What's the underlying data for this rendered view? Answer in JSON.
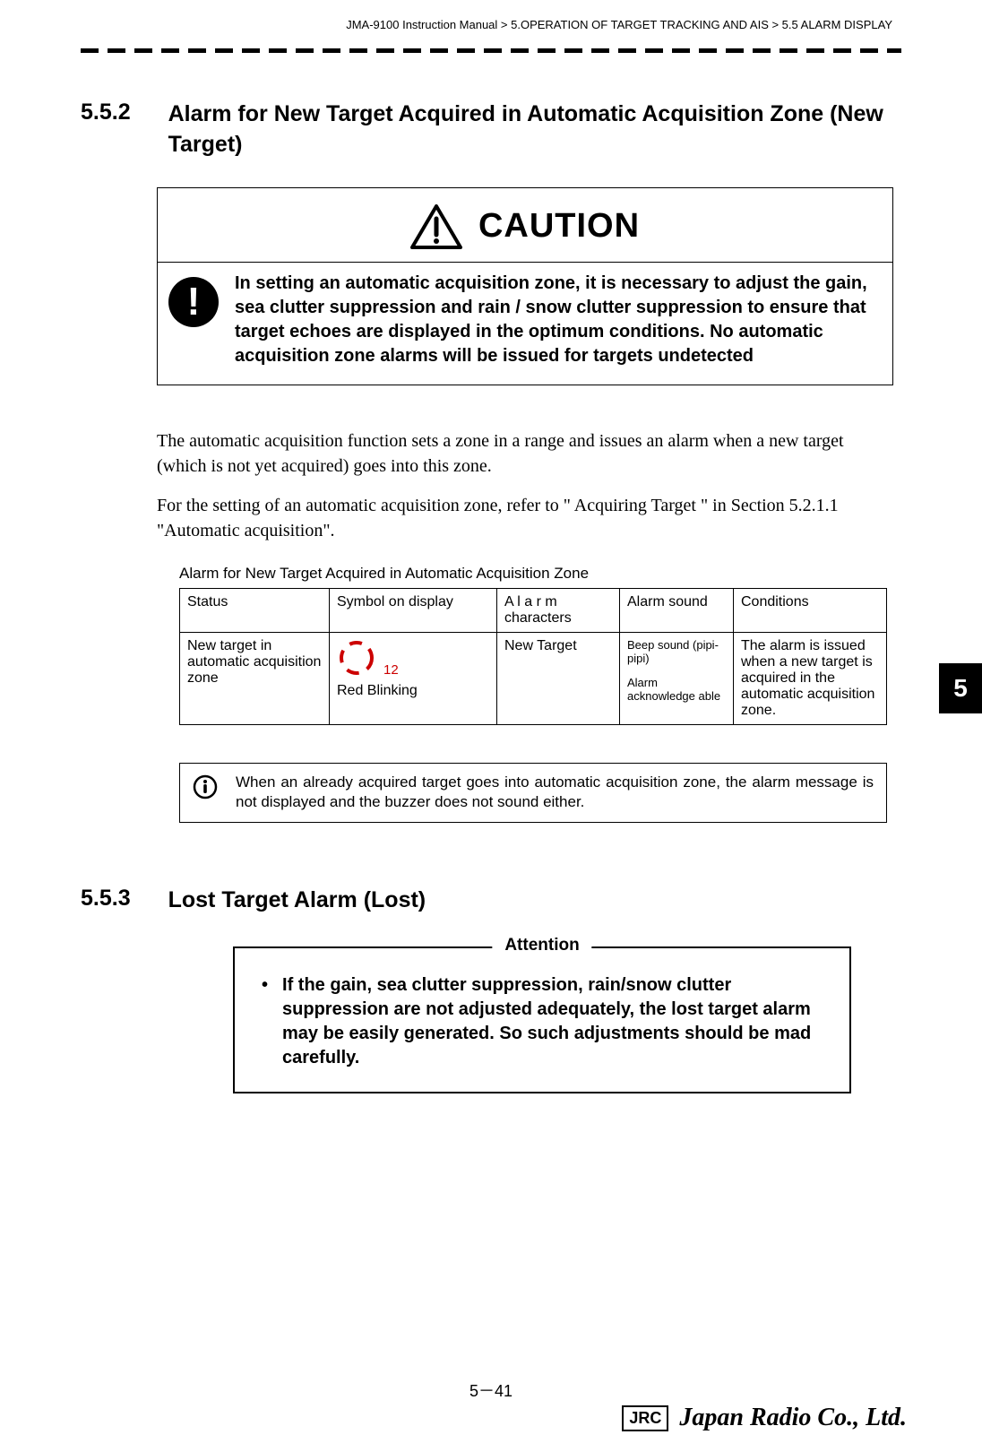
{
  "header": {
    "breadcrumb": "JMA-9100 Instruction Manual > 5.OPERATION OF TARGET TRACKING AND AIS > 5.5  ALARM DISPLAY"
  },
  "section552": {
    "number": "5.5.2",
    "title": "Alarm for New Target Acquired in Automatic Acquisition Zone (New Target)"
  },
  "caution": {
    "label": "CAUTION",
    "text": "In setting an automatic acquisition zone, it is necessary to adjust the gain, sea clutter suppression and rain / snow clutter suppression to ensure that target echoes are displayed in the optimum conditions. No automatic acquisition zone alarms will be issued for targets undetected"
  },
  "body": {
    "p1": "The automatic acquisition function sets a zone in a range and issues an alarm when a new target (which is not yet acquired) goes into this zone.",
    "p2": "For the setting of an automatic acquisition zone, refer to \" Acquiring Target \" in Section 5.2.1.1 \"Automatic acquisition\"."
  },
  "chapterTab": "5",
  "table": {
    "caption": "Alarm for New Target Acquired in Automatic Acquisition Zone",
    "headers": {
      "status": "Status",
      "symbol": "Symbol on display",
      "alarmChars": "A l a r m characters",
      "alarmSound": "Alarm sound",
      "conditions": "Conditions"
    },
    "row": {
      "status": "New target in automatic acquisition zone",
      "symbolId": "12",
      "symbolLabel": "Red Blinking",
      "alarmChars": "New Target",
      "alarmSoundBeep": "Beep sound (pipi-pipi)",
      "alarmSoundAck": "Alarm acknowledge able",
      "conditions": "The alarm is issued when a new target is acquired in the automatic acquisition zone."
    }
  },
  "info": {
    "text": "When an already acquired target goes into automatic acquisition zone, the alarm message is not displayed and the buzzer does not sound either."
  },
  "section553": {
    "number": "5.5.3",
    "title": "Lost Target Alarm (Lost)"
  },
  "attention": {
    "label": "Attention",
    "bullet": "•",
    "text": "If the gain, sea clutter suppression, rain/snow clutter suppression are not adjusted adequately, the lost target alarm may be easily generated. So such adjustments should be mad carefully."
  },
  "footer": {
    "page": "5－41",
    "brand": "JRC",
    "company": "Japan Radio Co., Ltd."
  }
}
